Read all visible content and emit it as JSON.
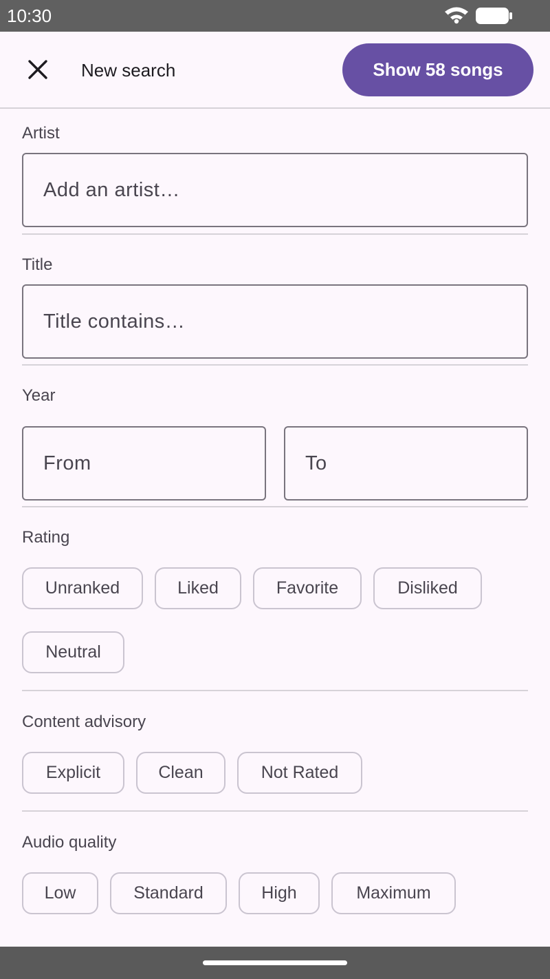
{
  "status_bar": {
    "time": "10:30",
    "icons": [
      "wifi-icon",
      "battery-icon"
    ]
  },
  "app_bar": {
    "close_icon": "close-icon",
    "title": "New search",
    "show_button_label": "Show 58 songs",
    "accent_color": "#6750a4"
  },
  "artist": {
    "label": "Artist",
    "placeholder": "Add an artist…",
    "value": ""
  },
  "title_field": {
    "label": "Title",
    "placeholder": "Title contains…",
    "value": ""
  },
  "year": {
    "label": "Year",
    "from_placeholder": "From",
    "to_placeholder": "To"
  },
  "rating": {
    "label": "Rating",
    "options": [
      "Unranked",
      "Liked",
      "Favorite",
      "Disliked",
      "Neutral"
    ]
  },
  "content_advisory": {
    "label": "Content advisory",
    "options": [
      "Explicit",
      "Clean",
      "Not Rated"
    ]
  },
  "audio_quality": {
    "label": "Audio quality",
    "options": [
      "Low",
      "Standard",
      "High",
      "Maximum"
    ]
  }
}
